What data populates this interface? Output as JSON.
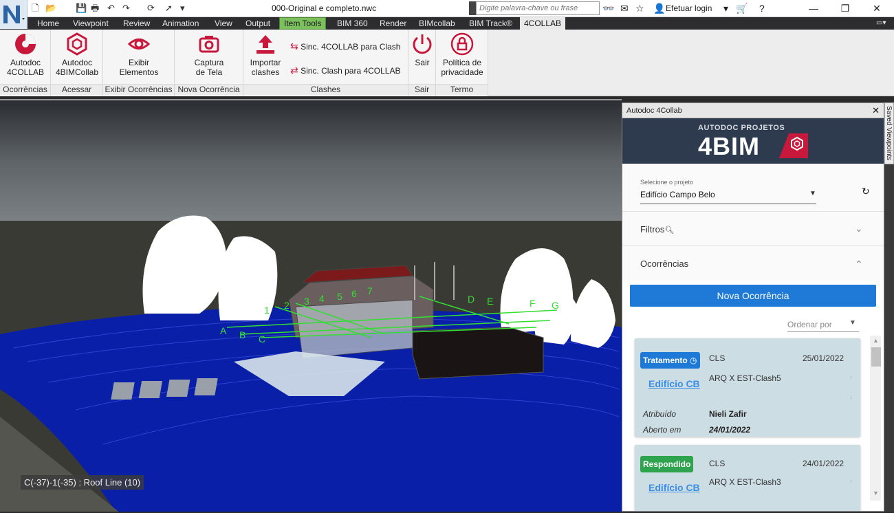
{
  "window": {
    "title": "000-Original e completo.nwc",
    "search_placeholder": "Digite palavra-chave ou frase",
    "login_label": "Efetuar login"
  },
  "menu": {
    "items": [
      "Home",
      "Viewpoint",
      "Review",
      "Animation",
      "View",
      "Output",
      "Item Tools",
      "BIM 360",
      "Render",
      "BIMcollab",
      "BIM Track®",
      "4COLLAB"
    ]
  },
  "ribbon": {
    "buttons": {
      "autodoc_4collab": "Autodoc\n4COLLAB",
      "autodoc_4bimcollab": "Autodoc\n4BIMCollab",
      "exibir_elementos": "Exibir\nElementos",
      "captura_de_tela": "Captura\nde Tela",
      "importar_clashes": "Importar\nclashes",
      "sinc_4collab_para_clash": "Sinc. 4COLLAB para Clash",
      "sinc_clash_para_4collab": "Sinc. Clash para 4COLLAB",
      "sair": "Sair",
      "politica_de_privacidade": "Política de\nprivacidade"
    },
    "groups": {
      "ocorrencias": "Ocorrências",
      "acessar": "Acessar",
      "exibir_ocorrencias": "Exibir Ocorrências",
      "nova_ocorrencia": "Nova Ocorrência",
      "clashes": "Clashes",
      "sair": "Sair",
      "termo": "Termo"
    }
  },
  "viewport": {
    "status_text": "C(-37)-1(-35) : Roof Line (10)",
    "grid_labels": [
      "1",
      "2",
      "3",
      "4",
      "5",
      "6",
      "7",
      "A",
      "B",
      "C",
      "D",
      "E",
      "F",
      "G"
    ]
  },
  "panel": {
    "title": "Autodoc 4Collab",
    "brand_sub": "AUTODOC PROJETOS",
    "brand_main": "4BIM",
    "project_label": "Selecione o projeto",
    "project_value": "Edifício Campo Belo",
    "filters_label": "Filtros",
    "occurrences_label": "Ocorrências",
    "new_button": "Nova Ocorrência",
    "sort_label": "Ordenar por",
    "cards": [
      {
        "status": "Tratamento",
        "status_color": "#1e7ad6",
        "code": "CLS",
        "date": "25/01/2022",
        "clash": "ARQ X EST-Clash5",
        "link": "Edifício CB",
        "assigned_label": "Atribuído",
        "assigned_value": "Nieli Zafir",
        "opened_label": "Aberto em",
        "opened_value": "24/01/2022"
      },
      {
        "status": "Respondido",
        "status_color": "#2ea44f",
        "code": "CLS",
        "date": "24/01/2022",
        "clash": "ARQ X EST-Clash3",
        "link": "Edifício CB"
      }
    ]
  },
  "saved_viewpoints_tab": "Saved Viewpoints"
}
